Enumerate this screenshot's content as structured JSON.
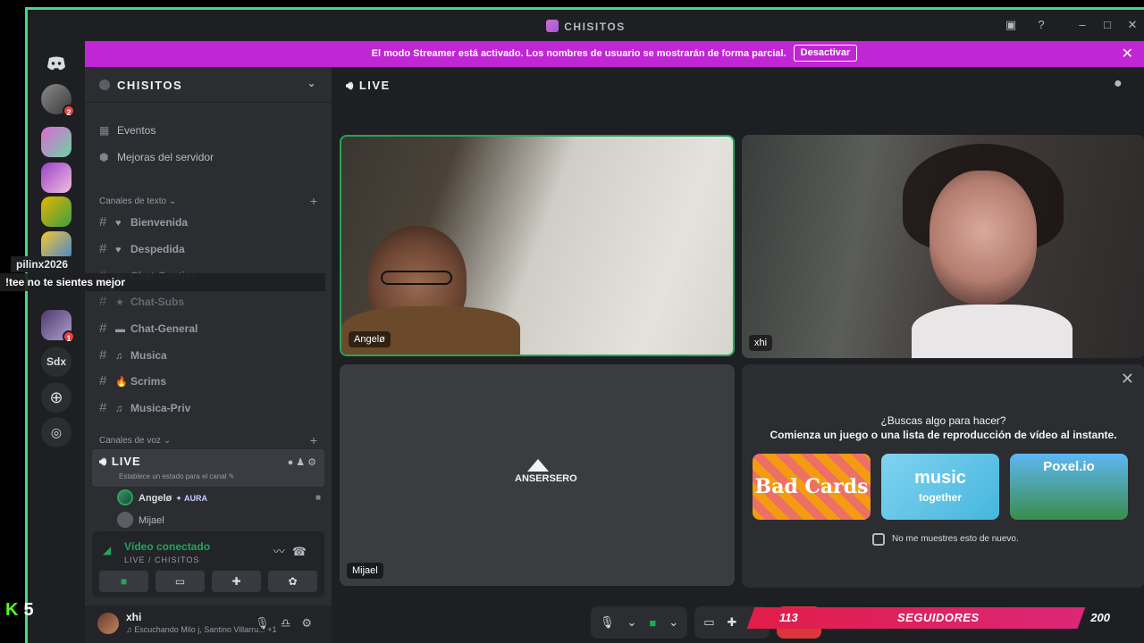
{
  "window": {
    "title": "CHISITOS"
  },
  "colors": {
    "accent": "#c026d3",
    "online": "#23a55a",
    "speaking_border": "#23a55a",
    "danger": "#da373c"
  },
  "banner": {
    "text": "El modo Streamer está activado. Los nombres de usuario se mostrarán de forma parcial.",
    "button": "Desactivar"
  },
  "rail": {
    "text_server": "Sdx",
    "badges": [
      "2",
      "1"
    ]
  },
  "sidebar": {
    "guild_name": "CHISITOS",
    "nav": [
      {
        "label": "Eventos",
        "icon": "calendar-icon"
      },
      {
        "label": "Mejoras del servidor",
        "icon": "boost-icon"
      }
    ],
    "text_category": "Canales de texto",
    "text_channels": [
      {
        "emoji": "♥",
        "name": "Bienvenida"
      },
      {
        "emoji": "♥",
        "name": "Despedida"
      },
      {
        "emoji": "◆",
        "name": "Chat-Gestion"
      },
      {
        "emoji": "★",
        "name": "Chat-Subs"
      },
      {
        "emoji": "▬",
        "name": "Chat-General"
      },
      {
        "emoji": "♫",
        "name": "Musica"
      },
      {
        "emoji": "🔥",
        "name": "Scrims"
      },
      {
        "emoji": "♫",
        "name": "Musica-Priv"
      }
    ],
    "voice_category": "Canales de voz",
    "voice_channel": {
      "name": "LIVE",
      "status": "Establece un estado para el canal"
    },
    "voice_users": [
      {
        "name": "Angelø",
        "tag": "AURA"
      },
      {
        "name": "Mijael",
        "tag": ""
      }
    ],
    "connection": {
      "status": "Vídeo conectado",
      "location": "LIVE / CHISITOS"
    },
    "user": {
      "name": "xhi",
      "activity": "Escuchando Milo j, Santino Villarru...",
      "activity_extra": "+1"
    }
  },
  "main": {
    "channel": "LIVE",
    "tiles": [
      {
        "name": "Angelø"
      },
      {
        "name": "xhi"
      },
      {
        "name": "Mijael",
        "logo": "ANSERSERO"
      }
    ],
    "activity": {
      "question": "¿Buscas algo para hacer?",
      "subtitle": "Comienza un juego o una lista de reproducción de vídeo al instante.",
      "cards": [
        {
          "title": "Bad Cards"
        },
        {
          "title": "music",
          "subtitle": "together"
        },
        {
          "title": "Poxel.io"
        }
      ],
      "dont_show": "No me muestres esto de nuevo."
    }
  },
  "overlay": {
    "chat_user": "pilinx2026",
    "chat_message": "!tee no te sientes mejor",
    "followers_current": "113",
    "followers_label": "SEGUIDORES",
    "followers_goal": "200",
    "kick_count": "5"
  }
}
